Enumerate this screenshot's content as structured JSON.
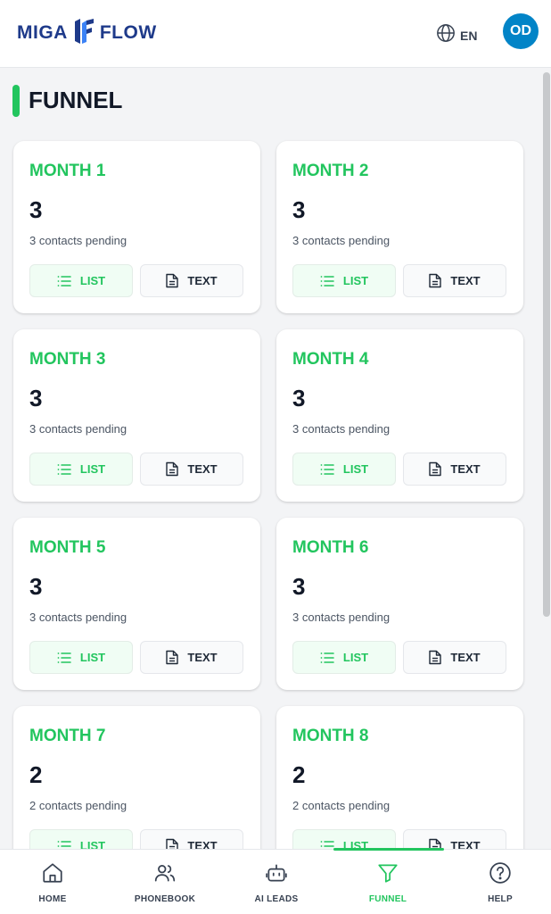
{
  "header": {
    "logo_left": "MIGA",
    "logo_right": "FLOW",
    "language": "EN",
    "avatar_initials": "OD"
  },
  "page": {
    "title": "FUNNEL"
  },
  "cards": [
    {
      "title": "MONTH 1",
      "count": "3",
      "pending": "3 contacts pending"
    },
    {
      "title": "MONTH 2",
      "count": "3",
      "pending": "3 contacts pending"
    },
    {
      "title": "MONTH 3",
      "count": "3",
      "pending": "3 contacts pending"
    },
    {
      "title": "MONTH 4",
      "count": "3",
      "pending": "3 contacts pending"
    },
    {
      "title": "MONTH 5",
      "count": "3",
      "pending": "3 contacts pending"
    },
    {
      "title": "MONTH 6",
      "count": "3",
      "pending": "3 contacts pending"
    },
    {
      "title": "MONTH 7",
      "count": "2",
      "pending": "2 contacts pending"
    },
    {
      "title": "MONTH 8",
      "count": "2",
      "pending": "2 contacts pending"
    }
  ],
  "buttons": {
    "list": "LIST",
    "text": "TEXT"
  },
  "nav": {
    "items": [
      {
        "label": "HOME",
        "icon": "home-icon"
      },
      {
        "label": "PHONEBOOK",
        "icon": "users-icon"
      },
      {
        "label": "AI LEADS",
        "icon": "bot-icon"
      },
      {
        "label": "FUNNEL",
        "icon": "funnel-icon"
      },
      {
        "label": "HELP",
        "icon": "help-icon"
      }
    ],
    "active": "FUNNEL"
  },
  "colors": {
    "accent": "#22c55e",
    "avatar": "#0284c7",
    "logo": "#1e3a8a",
    "text": "#111827"
  }
}
